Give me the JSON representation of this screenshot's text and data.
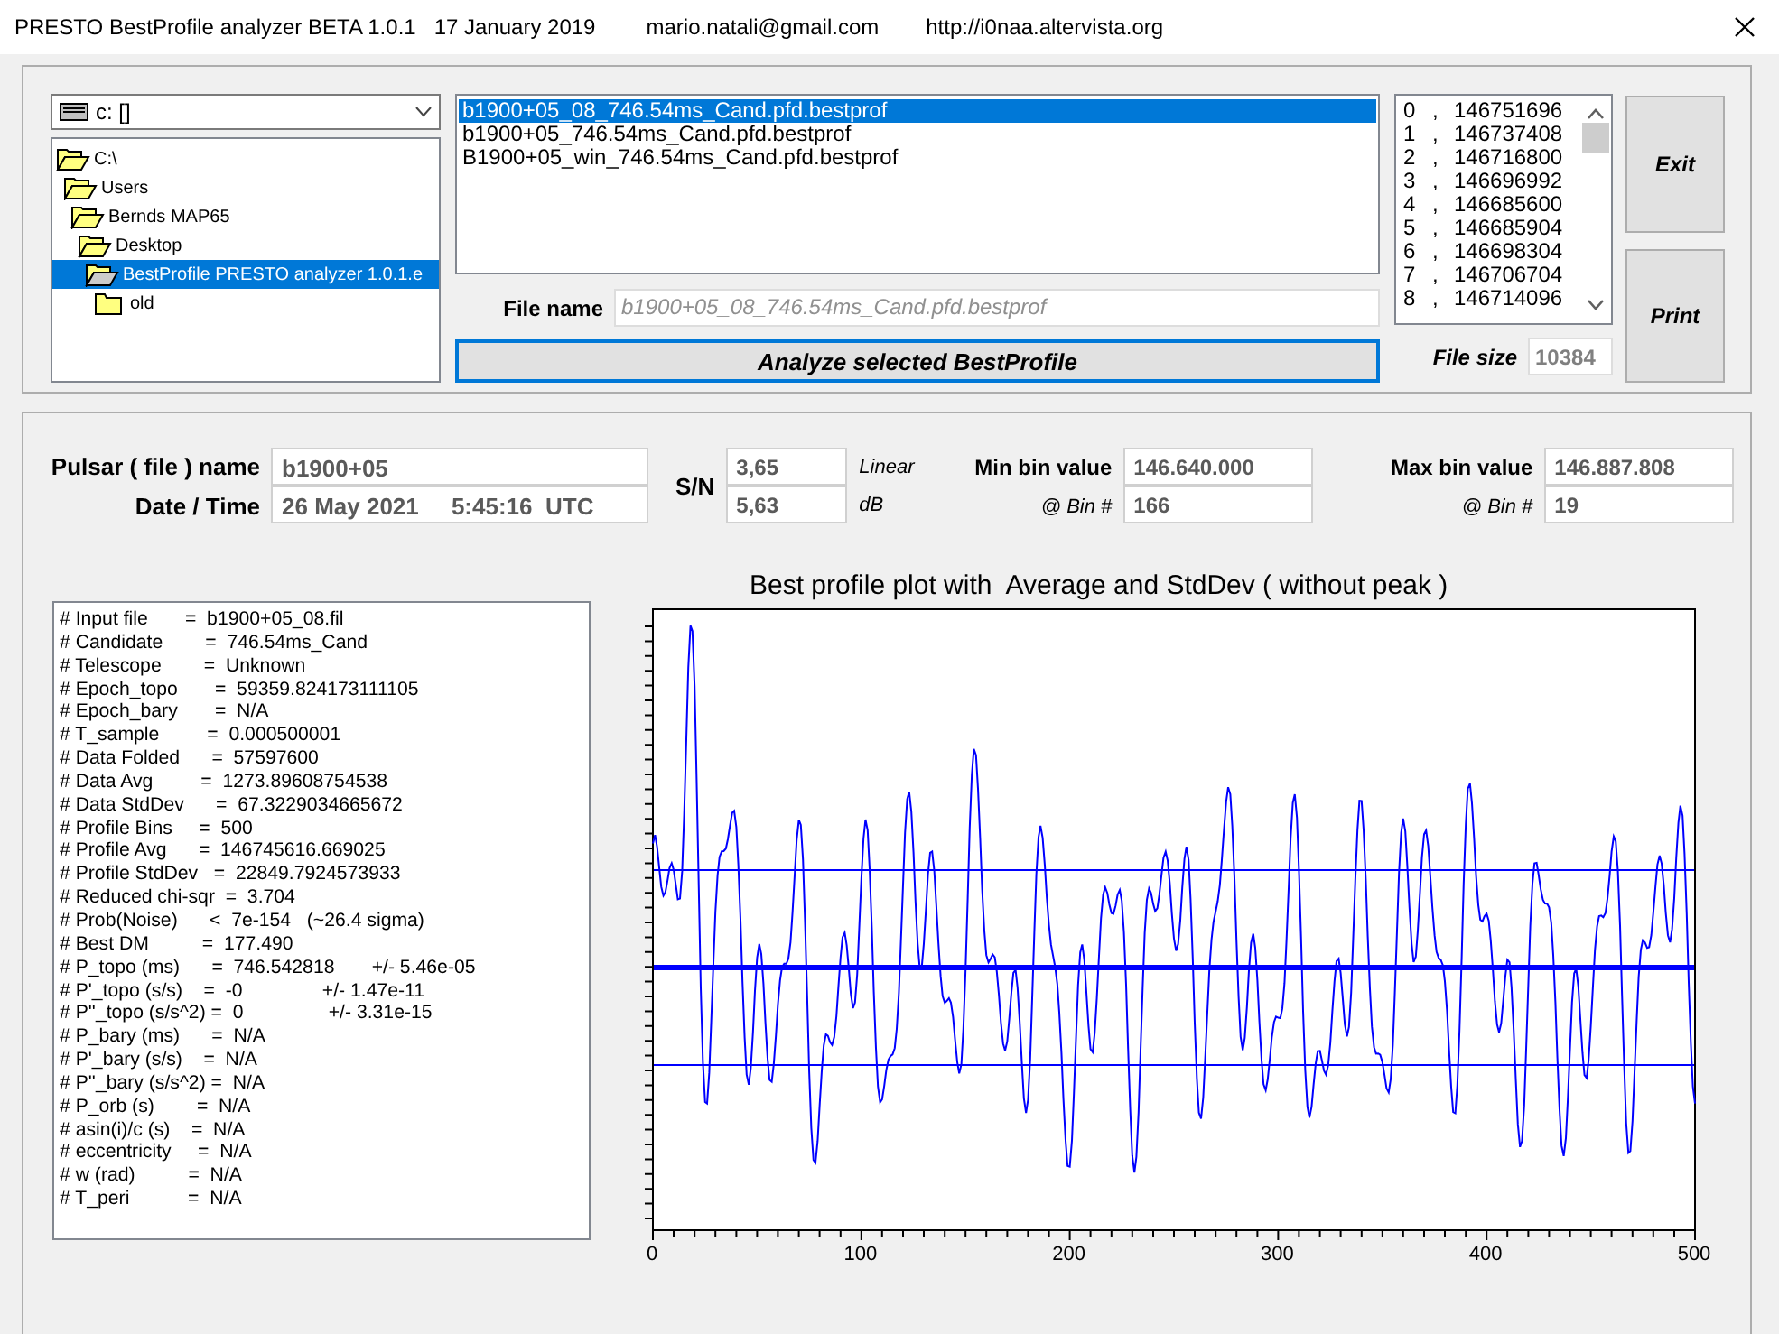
{
  "window": {
    "title": "PRESTO BestProfile analyzer BETA 1.0.1",
    "date": "17 January 2019",
    "email": "mario.natali@gmail.com",
    "url": "http://i0naa.altervista.org"
  },
  "drive": {
    "value": "c: []"
  },
  "folders": [
    {
      "name": "C:\\",
      "expanded": true,
      "selected": false,
      "children": [
        {
          "name": "Users",
          "expanded": true,
          "selected": false,
          "children": [
            {
              "name": "Bernds MAP65",
              "expanded": true,
              "selected": false,
              "children": [
                {
                  "name": "Desktop",
                  "expanded": true,
                  "selected": false,
                  "children": [
                    {
                      "name": "BestProfile PRESTO analyzer 1.0.1.e",
                      "expanded": true,
                      "selected": true,
                      "children": [
                        {
                          "name": "old",
                          "expanded": false,
                          "selected": false
                        }
                      ]
                    }
                  ]
                }
              ]
            }
          ]
        }
      ]
    }
  ],
  "files": [
    {
      "name": "b1900+05_08_746.54ms_Cand.pfd.bestprof",
      "selected": true
    },
    {
      "name": "b1900+05_746.54ms_Cand.pfd.bestprof",
      "selected": false
    },
    {
      "name": "B1900+05_win_746.54ms_Cand.pfd.bestprof",
      "selected": false
    }
  ],
  "file_name": {
    "label": "File name",
    "value": "b1900+05_08_746.54ms_Cand.pfd.bestprof"
  },
  "analyze_button": {
    "label": "Analyze selected BestProfile"
  },
  "bins": [
    {
      "index": "0",
      "separator": ",",
      "value": "146751696"
    },
    {
      "index": "1",
      "separator": ",",
      "value": "146737408"
    },
    {
      "index": "2",
      "separator": ",",
      "value": "146716800"
    },
    {
      "index": "3",
      "separator": ",",
      "value": "146696992"
    },
    {
      "index": "4",
      "separator": ",",
      "value": "146685600"
    },
    {
      "index": "5",
      "separator": ",",
      "value": "146685904"
    },
    {
      "index": "6",
      "separator": ",",
      "value": "146698304"
    },
    {
      "index": "7",
      "separator": ",",
      "value": "146706704"
    },
    {
      "index": "8",
      "separator": ",",
      "value": "146714096"
    }
  ],
  "file_size": {
    "label": "File size",
    "value": "10384"
  },
  "buttons": [
    {
      "label": "Exit"
    },
    {
      "label": "Print"
    }
  ],
  "pulsar": {
    "name_label": "Pulsar ( file ) name",
    "name": "b1900+05",
    "date_label": "Date / Time",
    "date": "26 May 2021     5:45:16  UTC"
  },
  "snr": {
    "label": "S/N",
    "linear": "3,65",
    "linear_unit": "Linear",
    "db": "5,63",
    "db_unit": "dB"
  },
  "min_bin": {
    "label": "Min bin value",
    "value": "146.640.000",
    "bin_label": "@ Bin #",
    "bin": "166"
  },
  "max_bin": {
    "label": "Max bin value",
    "value": "146.887.808",
    "bin_label": "@ Bin #",
    "bin": "19"
  },
  "info_lines": [
    "# Input file       =  b1900+05_08.fil",
    "# Candidate        =  746.54ms_Cand",
    "# Telescope        =  Unknown",
    "# Epoch_topo       =  59359.824173111105",
    "# Epoch_bary       =  N/A",
    "# T_sample         =  0.000500001",
    "# Data Folded      =  57597600",
    "# Data Avg         =  1273.89608754538",
    "# Data StdDev      =  67.3229034665672",
    "# Profile Bins     =  500",
    "# Profile Avg      =  146745616.669025",
    "# Profile StdDev   =  22849.7924573933",
    "# Reduced chi-sqr  =  3.704",
    "# Prob(Noise)      <  7e-154   (~26.4 sigma)",
    "# Best DM          =  177.490",
    "# P_topo (ms)      =  746.542818       +/- 5.46e-05",
    "# P'_topo (s/s)    =  -0               +/- 1.47e-11",
    "# P''_topo (s/s^2) =  0                +/- 3.31e-15",
    "# P_bary (ms)      =  N/A",
    "# P'_bary (s/s)    =  N/A",
    "# P''_bary (s/s^2) =  N/A",
    "# P_orb (s)        =  N/A",
    "# asin(i)/c (s)    =  N/A",
    "# eccentricity     =  N/A",
    "# w (rad)          =  N/A",
    "# T_peri           =  N/A"
  ],
  "plot": {
    "title": "Best profile plot with  Average and StdDev ( without peak )",
    "x_labels": [
      "0",
      "100",
      "200",
      "300",
      "400",
      "500"
    ]
  }
}
